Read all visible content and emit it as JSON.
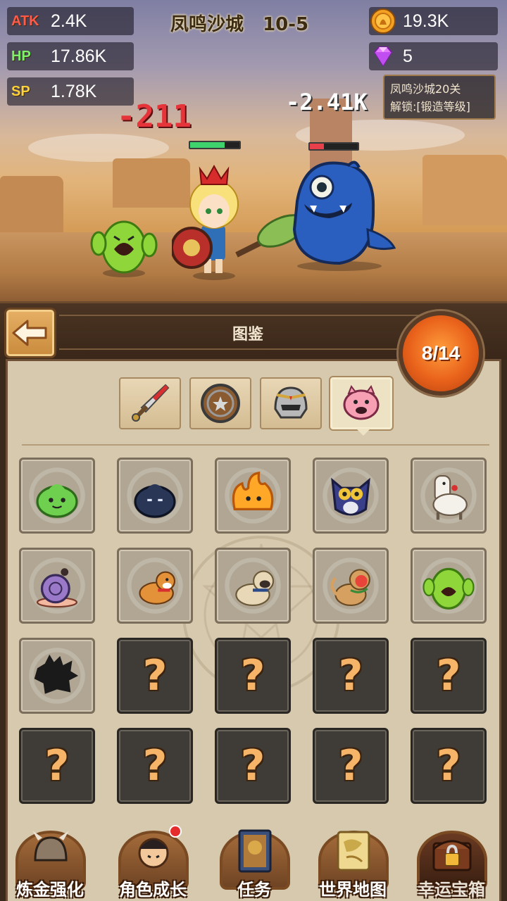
{
  "stats": {
    "atk": {
      "label": "ATK",
      "value": "2.4K",
      "color": "#ff5a4a"
    },
    "hp": {
      "label": "HP",
      "value": "17.86K",
      "color": "#7ef06a"
    },
    "sp": {
      "label": "SP",
      "value": "1.78K",
      "color": "#ffd23a"
    }
  },
  "stage": {
    "name": "凤鸣沙城",
    "level": "10-5"
  },
  "resources": {
    "gold": "19.3K",
    "gems": "5"
  },
  "lock_tip": {
    "line1": "凤鸣沙城20关",
    "line2": "解锁:[锻造等级]"
  },
  "battle": {
    "player_damage": "-211",
    "enemy_damage": "-2.41K",
    "player_hp_ratio": 0.7,
    "enemy_hp_ratio": 0.3
  },
  "panel": {
    "title": "图鉴",
    "counter": "8/14"
  },
  "tabs": [
    {
      "icon": "sword-icon",
      "active": false
    },
    {
      "icon": "shield-icon",
      "active": false
    },
    {
      "icon": "helmet-icon",
      "active": false
    },
    {
      "icon": "pig-monster-icon",
      "active": true
    }
  ],
  "cards": [
    {
      "icon": "green-slime-icon",
      "locked": false
    },
    {
      "icon": "dark-slime-icon",
      "locked": false
    },
    {
      "icon": "fire-slime-icon",
      "locked": false
    },
    {
      "icon": "owl-icon",
      "locked": false
    },
    {
      "icon": "alpaca-icon",
      "locked": false
    },
    {
      "icon": "snail-icon",
      "locked": false
    },
    {
      "icon": "shiba-dog-icon",
      "locked": false
    },
    {
      "icon": "pug-dog-icon",
      "locked": false
    },
    {
      "icon": "monkey-icon",
      "locked": false
    },
    {
      "icon": "cactus-monster-icon",
      "locked": false
    },
    {
      "icon": "silhouette-icon",
      "locked": false
    },
    {
      "icon": "question-mark",
      "locked": true,
      "text": "?"
    },
    {
      "icon": "question-mark",
      "locked": true,
      "text": "?"
    },
    {
      "icon": "question-mark",
      "locked": true,
      "text": "?"
    },
    {
      "icon": "question-mark",
      "locked": true,
      "text": "?"
    },
    {
      "icon": "question-mark",
      "locked": true,
      "text": "?"
    },
    {
      "icon": "question-mark",
      "locked": true,
      "text": "?"
    },
    {
      "icon": "question-mark",
      "locked": true,
      "text": "?"
    },
    {
      "icon": "question-mark",
      "locked": true,
      "text": "?"
    },
    {
      "icon": "question-mark",
      "locked": true,
      "text": "?"
    }
  ],
  "nav": [
    {
      "label": "炼金强化",
      "icon": "alchemy-helmet-icon",
      "dot": false
    },
    {
      "label": "角色成长",
      "icon": "character-icon",
      "dot": true
    },
    {
      "label": "任务",
      "icon": "quest-book-icon",
      "dot": false
    },
    {
      "label": "世界地图",
      "icon": "world-map-icon",
      "dot": false
    },
    {
      "label": "幸运宝箱",
      "icon": "lucky-chest-icon",
      "dot": false
    }
  ]
}
